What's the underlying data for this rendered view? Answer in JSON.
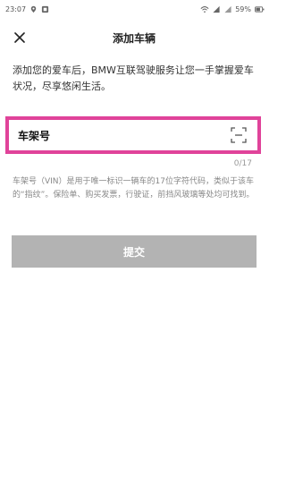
{
  "status_bar": {
    "time": "23:07",
    "battery": "59%"
  },
  "header": {
    "title": "添加车辆",
    "close_icon": "close-icon"
  },
  "intro": {
    "text": "添加您的爱车后，BMW互联驾驶服务让您一手掌握爱车状况，尽享悠闲生活。"
  },
  "vin_field": {
    "label": "车架号",
    "value": "",
    "scan_icon": "scan-icon",
    "counter": "0/17"
  },
  "help": {
    "text": "车架号（VIN）是用于唯一标识一辆车的17位字符代码，类似于该车的“指纹”。保险单、购买发票，行驶证，前挡风玻璃等处均可找到。"
  },
  "submit": {
    "label": "提交"
  },
  "colors": {
    "highlight_border": "#e0439a",
    "submit_bg": "#b3b3b3"
  }
}
